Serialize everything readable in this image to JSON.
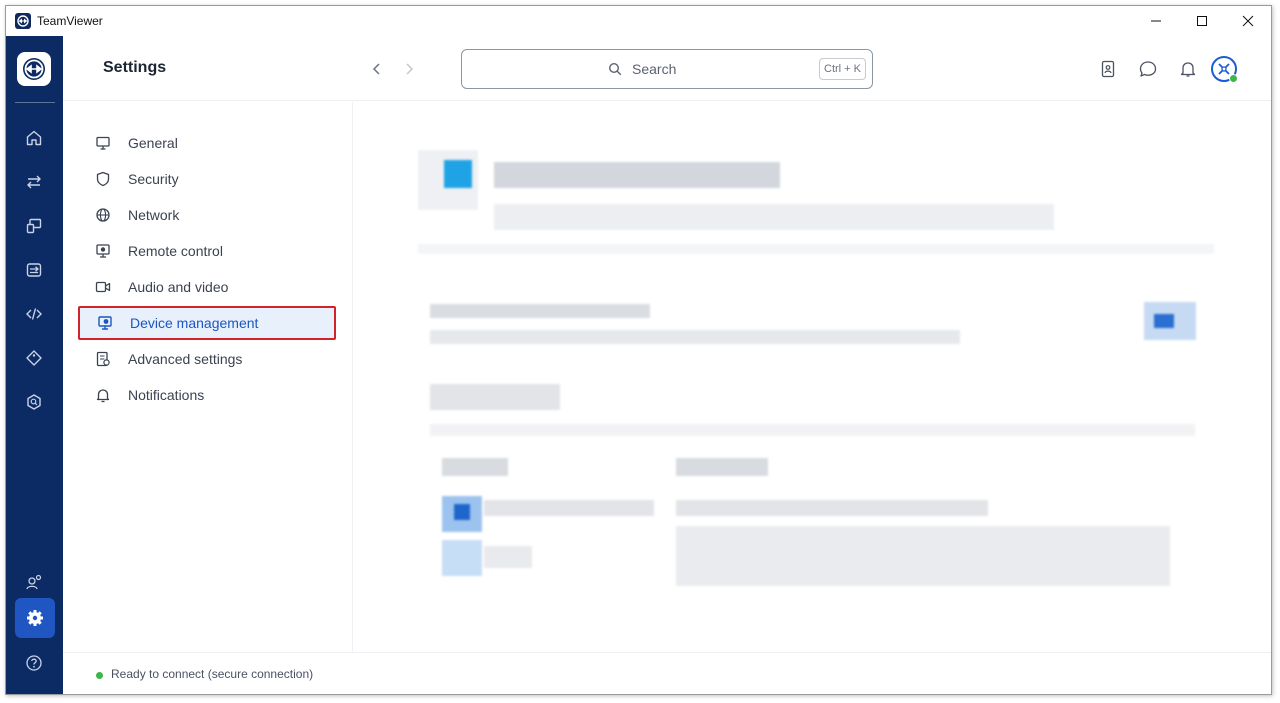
{
  "window": {
    "title": "TeamViewer"
  },
  "header": {
    "title": "Settings",
    "search_placeholder": "Search",
    "search_shortcut": "Ctrl + K"
  },
  "settings_nav": [
    {
      "label": "General",
      "icon": "monitor-icon"
    },
    {
      "label": "Security",
      "icon": "shield-icon"
    },
    {
      "label": "Network",
      "icon": "globe-icon"
    },
    {
      "label": "Remote control",
      "icon": "remote-control-icon"
    },
    {
      "label": "Audio and video",
      "icon": "video-icon"
    },
    {
      "label": "Device management",
      "icon": "device-management-icon",
      "active": true
    },
    {
      "label": "Advanced settings",
      "icon": "advanced-settings-icon"
    },
    {
      "label": "Notifications",
      "icon": "bell-icon"
    }
  ],
  "status": {
    "text": "Ready to connect (secure connection)",
    "color": "#3cb54a"
  },
  "colors": {
    "rail": "#0c2a63",
    "accent": "#1a55c4",
    "highlight_border": "#d2222a"
  }
}
